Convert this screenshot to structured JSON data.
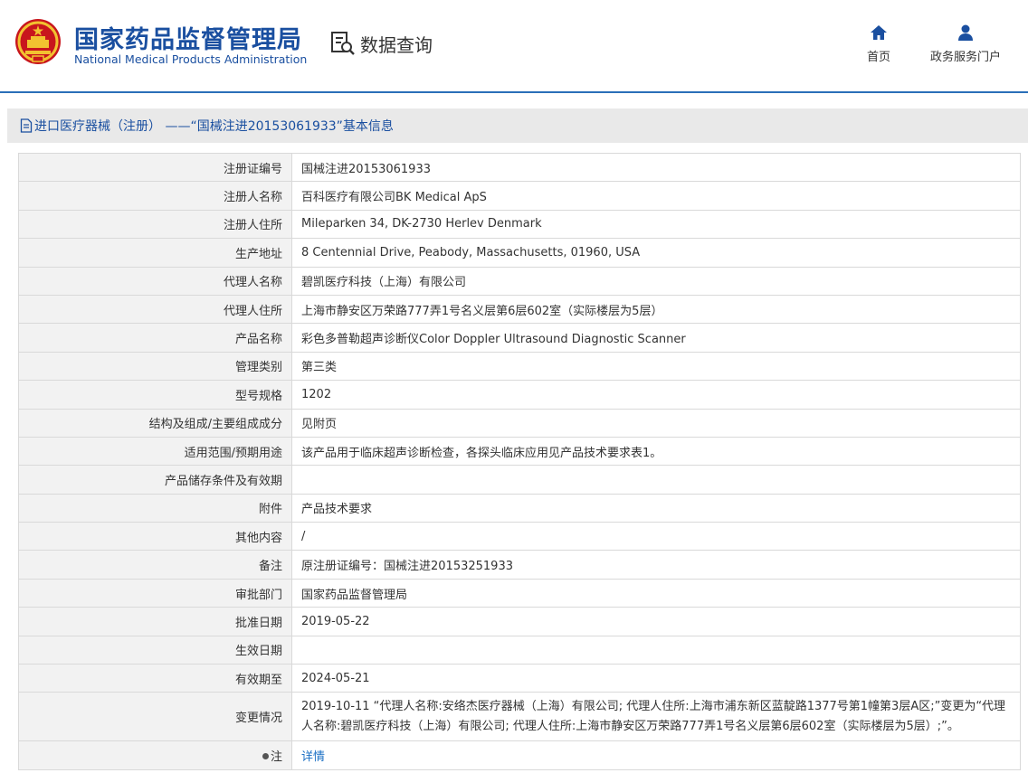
{
  "header": {
    "org_name_cn": "国家药品监督管理局",
    "org_name_en": "National Medical Products Administration",
    "section_title": "数据查询",
    "nav": [
      {
        "label": "首页",
        "icon": "home-icon"
      },
      {
        "label": "政务服务门户",
        "icon": "user-icon"
      }
    ]
  },
  "breadcrumb": {
    "text": "进口医疗器械（注册） ——“国械注进20153061933”基本信息"
  },
  "rows": [
    {
      "label": "注册证编号",
      "value": "国械注进20153061933"
    },
    {
      "label": "注册人名称",
      "value": "百科医疗有限公司BK Medical ApS"
    },
    {
      "label": "注册人住所",
      "value": "Mileparken 34, DK-2730 Herlev Denmark"
    },
    {
      "label": "生产地址",
      "value": "8 Centennial Drive, Peabody, Massachusetts, 01960, USA"
    },
    {
      "label": "代理人名称",
      "value": "碧凯医疗科技（上海）有限公司"
    },
    {
      "label": "代理人住所",
      "value": "上海市静安区万荣路777弄1号名义层第6层602室（实际楼层为5层）"
    },
    {
      "label": "产品名称",
      "value": "彩色多普勒超声诊断仪Color Doppler Ultrasound Diagnostic Scanner"
    },
    {
      "label": "管理类别",
      "value": "第三类"
    },
    {
      "label": "型号规格",
      "value": "1202"
    },
    {
      "label": "结构及组成/主要组成成分",
      "value": "见附页"
    },
    {
      "label": "适用范围/预期用途",
      "value": "该产品用于临床超声诊断检查，各探头临床应用见产品技术要求表1。"
    },
    {
      "label": "产品储存条件及有效期",
      "value": ""
    },
    {
      "label": "附件",
      "value": "产品技术要求"
    },
    {
      "label": "其他内容",
      "value": "/"
    },
    {
      "label": "备注",
      "value": "原注册证编号：国械注进20153251933"
    },
    {
      "label": "审批部门",
      "value": "国家药品监督管理局"
    },
    {
      "label": "批准日期",
      "value": "2019-05-22"
    },
    {
      "label": "生效日期",
      "value": ""
    },
    {
      "label": "有效期至",
      "value": "2024-05-21"
    },
    {
      "label": "变更情况",
      "value": "2019-10-11 “代理人名称:安络杰医疗器械（上海）有限公司; 代理人住所:上海市浦东新区蓝靛路1377号第1幢第3层A区;”变更为“代理人名称:碧凯医疗科技（上海）有限公司; 代理人住所:上海市静安区万荣路777弄1号名义层第6层602室（实际楼层为5层）;”。"
    }
  ],
  "note_row": {
    "label": "注",
    "link": "详情"
  }
}
